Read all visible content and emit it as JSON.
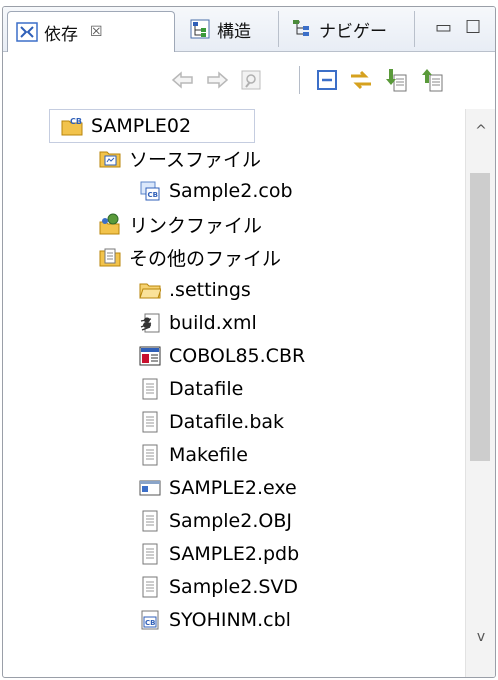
{
  "tabs": [
    {
      "label": "依存",
      "icon": "dependency-icon",
      "close": "☒",
      "active": true
    },
    {
      "label": "構造",
      "icon": "structure-icon",
      "active": false
    },
    {
      "label": "ナビゲー",
      "icon": "navigator-icon",
      "active": false
    }
  ],
  "window_controls": {
    "minimize": "▭",
    "maximize": "☐"
  },
  "toolbar": [
    "back-arrow-icon",
    "forward-arrow-icon",
    "home-icon",
    "collapse-all-icon",
    "link-with-editor-icon",
    "import-icon",
    "export-icon"
  ],
  "tree": {
    "root": {
      "label": "SAMPLE02",
      "icon": "cobol-project-icon"
    },
    "items": [
      {
        "label": "ソースファイル",
        "icon": "source-folder-icon",
        "level": 1
      },
      {
        "label": "Sample2.cob",
        "icon": "cobol-source-icon",
        "level": 2
      },
      {
        "label": "リンクファイル",
        "icon": "link-files-icon",
        "level": 1
      },
      {
        "label": "その他のファイル",
        "icon": "other-files-icon",
        "level": 1
      },
      {
        "label": ".settings",
        "icon": "folder-icon",
        "level": 2
      },
      {
        "label": "build.xml",
        "icon": "ant-file-icon",
        "level": 2
      },
      {
        "label": "COBOL85.CBR",
        "icon": "cbr-file-icon",
        "level": 2
      },
      {
        "label": "Datafile",
        "icon": "text-file-icon",
        "level": 2
      },
      {
        "label": "Datafile.bak",
        "icon": "text-file-icon",
        "level": 2
      },
      {
        "label": "Makefile",
        "icon": "text-file-icon",
        "level": 2
      },
      {
        "label": "SAMPLE2.exe",
        "icon": "exe-file-icon",
        "level": 2
      },
      {
        "label": "Sample2.OBJ",
        "icon": "text-file-icon",
        "level": 2
      },
      {
        "label": "SAMPLE2.pdb",
        "icon": "text-file-icon",
        "level": 2
      },
      {
        "label": "Sample2.SVD",
        "icon": "text-file-icon",
        "level": 2
      },
      {
        "label": "SYOHINM.cbl",
        "icon": "cbl-file-icon",
        "level": 2
      }
    ]
  },
  "scrollbar": {
    "up": "^",
    "down": "v"
  },
  "colors": {
    "accent": "#3c6fc8",
    "folder": "#f2c34c",
    "tab_border": "#9fa8b7"
  }
}
